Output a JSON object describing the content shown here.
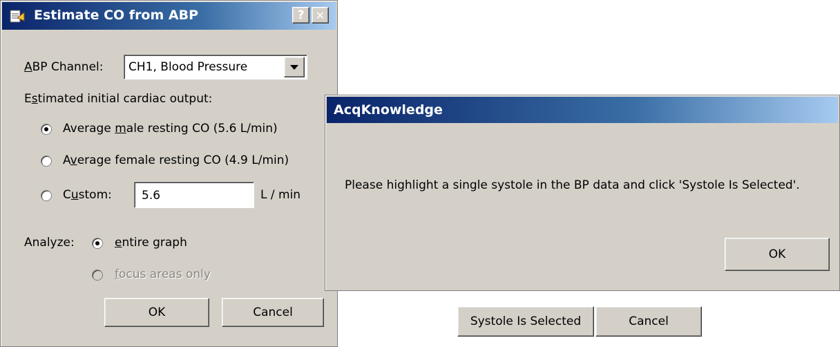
{
  "dialog1": {
    "title": "Estimate CO from ABP",
    "help_label": "?",
    "close_label": "✕",
    "abp_channel_pre": "A",
    "abp_channel_rest": "BP Channel:",
    "abp_channel_value": "CH1, Blood Pressure",
    "estimated_pre": "E",
    "estimated_u": "s",
    "estimated_rest": "timated initial cardiac output:",
    "male_pre": "Average ",
    "male_u": "m",
    "male_rest": "ale resting CO (5.6 L/min)",
    "female_pre": "A",
    "female_u": "v",
    "female_rest": "erage female resting CO (4.9 L/min)",
    "custom_pre": "C",
    "custom_u": "u",
    "custom_rest": "stom:",
    "custom_value": "5.6",
    "custom_unit": "L / min",
    "analyze_label": "Analyze:",
    "entire_u": "e",
    "entire_rest": "ntire graph",
    "focus_u": "f",
    "focus_rest": "ocus areas only",
    "ok_label": "OK",
    "cancel_label": "Cancel"
  },
  "dialog2": {
    "title": "AcqKnowledge",
    "message": "Please highlight a single systole in the BP data and click 'Systole Is Selected'.",
    "ok_label": "OK"
  },
  "bottom_buttons": {
    "systole_label": "Systole Is Selected",
    "cancel_label": "Cancel"
  },
  "selected_co_option": "male",
  "selected_analyze_option": "entire graph"
}
